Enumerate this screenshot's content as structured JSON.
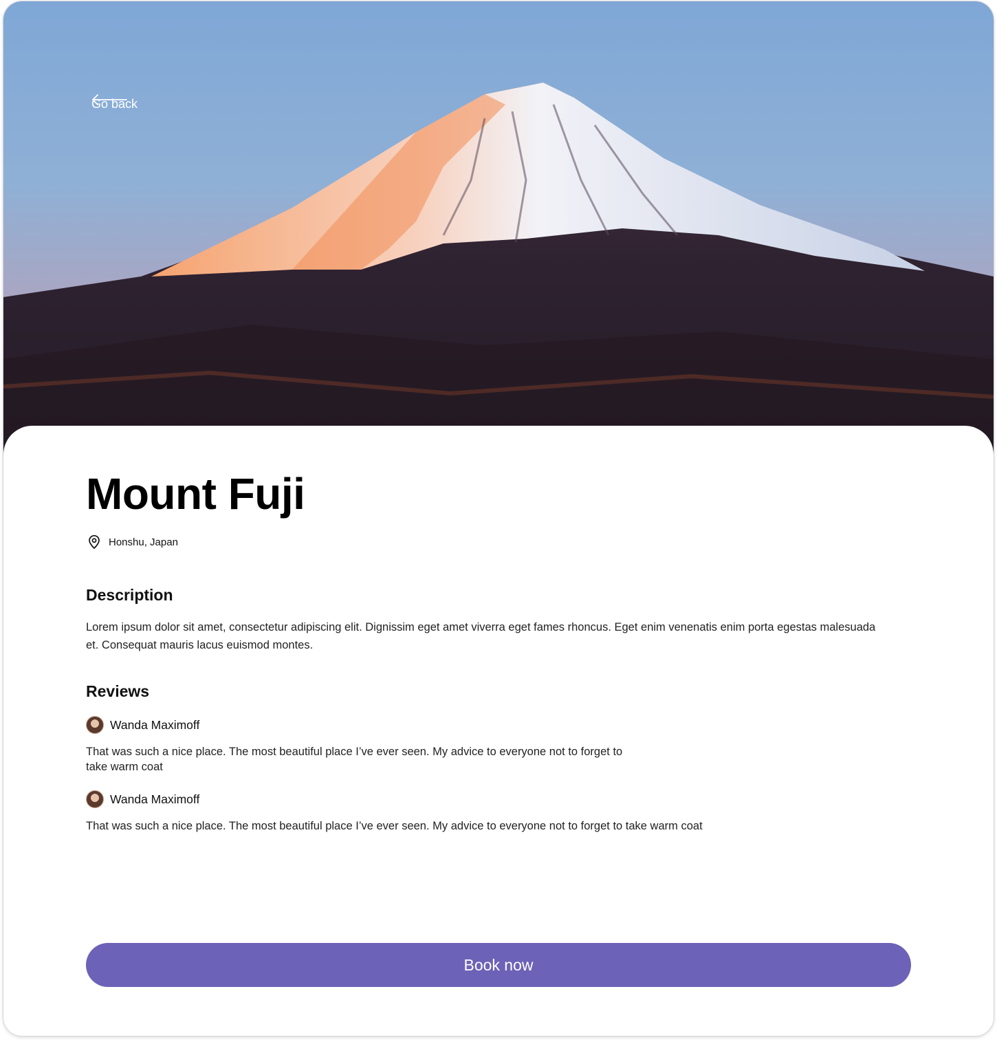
{
  "header": {
    "back_label": "Go back"
  },
  "place": {
    "name": "Mount Fuji",
    "location": "Honshu, Japan"
  },
  "description": {
    "heading": "Description",
    "text": "Lorem ipsum dolor sit amet, consectetur adipiscing elit. Dignissim eget amet viverra eget fames rhoncus. Eget enim venenatis enim porta egestas malesuada et. Consequat mauris lacus euismod montes."
  },
  "reviews": {
    "heading": "Reviews",
    "items": [
      {
        "author": "Wanda Maximoff",
        "line1": "That was such a nice place. The most beautiful place I’ve ever seen. My advice to everyone not to forget to",
        "line2": "take warm coat"
      },
      {
        "author": "Wanda Maximoff",
        "text": "That was such a nice place. The most beautiful place I’ve ever seen. My advice to everyone not to forget to take warm coat"
      }
    ]
  },
  "actions": {
    "book_label": "Book now"
  },
  "colors": {
    "accent": "#6c62b7",
    "text": "#111111"
  },
  "icons": {
    "back": "arrow-left-icon",
    "location": "map-pin-icon"
  }
}
